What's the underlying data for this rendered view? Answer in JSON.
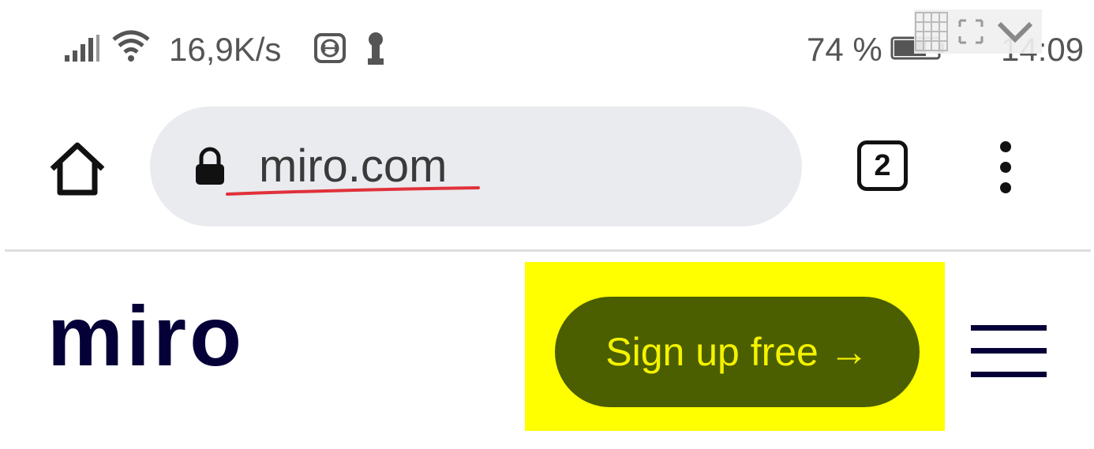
{
  "status_bar": {
    "network_speed": "16,9K/s",
    "battery_percent": "74 %",
    "time": "14:09",
    "icons": [
      "signal-icon",
      "wifi-icon",
      "teamviewer-icon",
      "key-icon",
      "battery-icon"
    ]
  },
  "browser": {
    "url": "miro.com",
    "tab_count": "2",
    "icons": [
      "home-icon",
      "lock-icon",
      "tabs-icon",
      "more-vert-icon"
    ],
    "annotation_color": "#e0313a"
  },
  "page": {
    "logo_text": "miro",
    "signup_label": "Sign up free →",
    "menu_icon": "hamburger-icon",
    "colors": {
      "brand": "#050038",
      "button_bg": "#4b5f00",
      "button_text": "#f4f200",
      "highlight": "#ffff00"
    }
  }
}
